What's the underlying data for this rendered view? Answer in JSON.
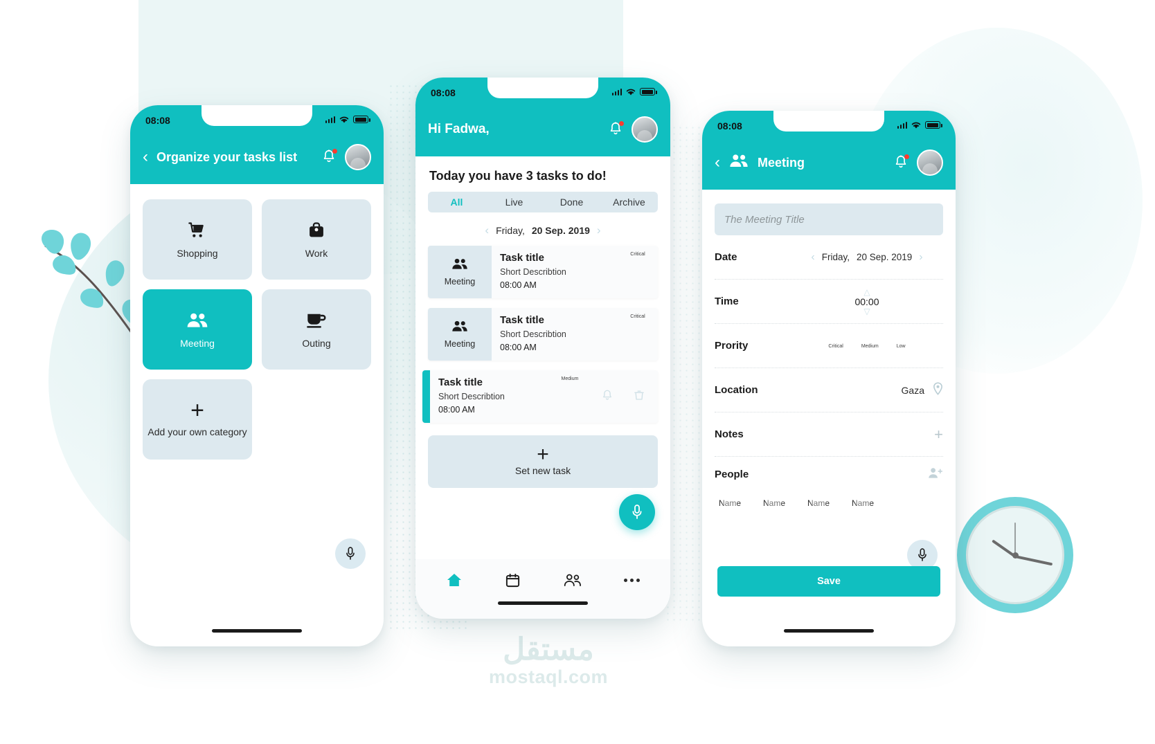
{
  "status_bar": {
    "time": "08:08"
  },
  "phone1": {
    "appbar": {
      "title": "Organize your tasks list",
      "back_icon": "chevron-left-icon",
      "bell_icon": "bell-icon",
      "avatar": "user-avatar"
    },
    "categories": [
      {
        "label": "Shopping",
        "icon": "shopping-cart-icon",
        "active": false
      },
      {
        "label": "Work",
        "icon": "briefcase-icon",
        "active": false
      },
      {
        "label": "Meeting",
        "icon": "people-icon",
        "active": true
      },
      {
        "label": "Outing",
        "icon": "coffee-cup-icon",
        "active": false
      },
      {
        "label": "Add your own category",
        "icon": "plus-icon",
        "active": false
      }
    ],
    "mic_icon": "microphone-icon"
  },
  "phone2": {
    "greeting": "Hi Fadwa,",
    "today_line": "Today you have 3 tasks to do!",
    "tabs": [
      {
        "label": "All",
        "active": true
      },
      {
        "label": "Live",
        "active": false
      },
      {
        "label": "Done",
        "active": false
      },
      {
        "label": "Archive",
        "active": false
      }
    ],
    "date_nav": {
      "prev_icon": "chevron-left-icon",
      "next_icon": "chevron-right-icon",
      "weekday": "Friday,",
      "date": "20 Sep. 2019"
    },
    "tasks": [
      {
        "category": "Meeting",
        "category_icon": "people-icon",
        "title": "Task title",
        "description": "Short Describtion",
        "time": "08:00 AM",
        "priority": "Critical",
        "priority_color": "#f01f1f",
        "highlighted": false
      },
      {
        "category": "Meeting",
        "category_icon": "people-icon",
        "title": "Task title",
        "description": "Short Describtion",
        "time": "08:00 AM",
        "priority": "Critical",
        "priority_color": "#f01f1f",
        "highlighted": false
      },
      {
        "category": "",
        "category_icon": "",
        "title": "Task title",
        "description": "Short Describtion",
        "time": "08:00 AM",
        "priority": "Medium",
        "priority_color": "#f5e617",
        "highlighted": true,
        "actions": [
          {
            "icon": "bell-icon"
          },
          {
            "icon": "trash-icon"
          }
        ]
      }
    ],
    "new_task": {
      "label": "Set new task",
      "icon": "plus-icon"
    },
    "mic_icon": "microphone-icon",
    "bottom_nav": [
      {
        "icon": "home-icon",
        "active": true
      },
      {
        "icon": "calendar-icon",
        "active": false
      },
      {
        "icon": "people-icon",
        "active": false
      },
      {
        "icon": "more-dots-icon",
        "active": false
      }
    ]
  },
  "phone3": {
    "appbar": {
      "title": "Meeting",
      "back_icon": "chevron-left-icon",
      "category_icon": "people-icon",
      "bell_icon": "bell-icon",
      "avatar": "user-avatar"
    },
    "title_input": {
      "placeholder": "The Meeting Title",
      "value": ""
    },
    "date_row": {
      "label": "Date",
      "weekday": "Friday,",
      "date": "20 Sep. 2019",
      "prev_icon": "chevron-left-icon",
      "next_icon": "chevron-right-icon"
    },
    "time_row": {
      "label": "Time",
      "value": "00:00",
      "up_icon": "caret-up-icon",
      "down_icon": "caret-down-icon"
    },
    "priority_row": {
      "label": "Prority",
      "options": [
        {
          "label": "Critical",
          "color": "#f01f1f"
        },
        {
          "label": "Medium",
          "color": "#f5e617"
        },
        {
          "label": "Low",
          "color": "#1ec81e"
        }
      ]
    },
    "location_row": {
      "label": "Location",
      "value": "Gaza",
      "icon": "map-pin-icon"
    },
    "notes_row": {
      "label": "Notes",
      "add_icon": "plus-icon"
    },
    "people_row": {
      "label": "People",
      "add_icon": "add-person-icon"
    },
    "people": [
      {
        "name": "Name"
      },
      {
        "name": "Name"
      },
      {
        "name": "Name"
      },
      {
        "name": "Name"
      }
    ],
    "mic_icon": "microphone-icon",
    "save_button": "Save"
  },
  "watermark": {
    "arabic": "مستقل",
    "latin": "mostaql.com"
  },
  "theme": {
    "accent": "#10bfc0",
    "tile": "#dde9ef",
    "critical": "#f01f1f",
    "medium": "#f5e617",
    "low": "#1ec81e"
  }
}
